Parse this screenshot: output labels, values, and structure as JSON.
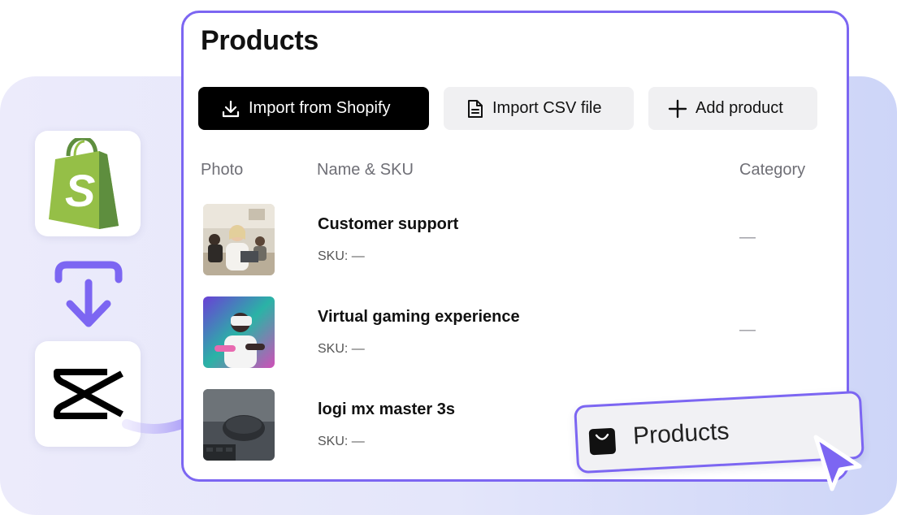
{
  "card": {
    "title": "Products",
    "buttons": {
      "import_shopify": "Import from Shopify",
      "import_csv": "Import CSV file",
      "add_product": "Add product"
    },
    "columns": {
      "photo": "Photo",
      "name": "Name & SKU",
      "category": "Category"
    },
    "rows": [
      {
        "name": "Customer support",
        "sku": "SKU: —",
        "category": "—",
        "photo": "office-photo"
      },
      {
        "name": "Virtual gaming experience",
        "sku": "SKU: —",
        "category": "—",
        "photo": "vr-gaming-photo"
      },
      {
        "name": "logi mx master 3s",
        "sku": "SKU: —",
        "category": "",
        "photo": "mouse-photo"
      }
    ]
  },
  "tag": {
    "label": "Products",
    "icon": "shopping-bag-icon"
  },
  "icons": {
    "shopify": "shopify-logo",
    "capcut": "capcut-logo",
    "import": "import-arrow-icon",
    "cursor": "cursor-icon"
  },
  "colors": {
    "accent": "#7c66f2",
    "primary_button": "#000000",
    "secondary_button": "#f0f0f2",
    "shopify_green": "#95bf47"
  }
}
